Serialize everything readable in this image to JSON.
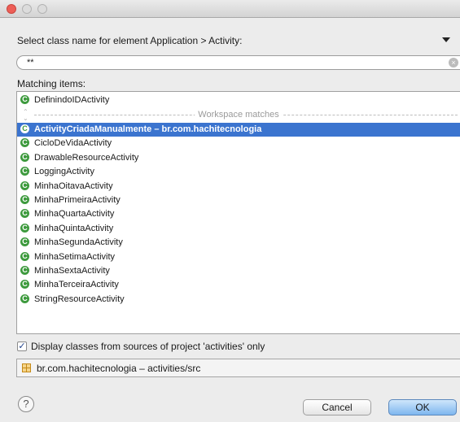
{
  "prompt": "Select class name for element Application > Activity:",
  "search": {
    "value": "**"
  },
  "matching_label": "Matching items:",
  "class_icon": "C",
  "list": {
    "top_item": "DefinindoIDActivity",
    "separator": "Workspace matches",
    "items": [
      "ActivityCriadaManualmente – br.com.hachitecnologia",
      "CicloDeVidaActivity",
      "DrawableResourceActivity",
      "LoggingActivity",
      "MinhaOitavaActivity",
      "MinhaPrimeiraActivity",
      "MinhaQuartaActivity",
      "MinhaQuintaActivity",
      "MinhaSegundaActivity",
      "MinhaSetimaActivity",
      "MinhaSextaActivity",
      "MinhaTerceiraActivity",
      "StringResourceActivity"
    ],
    "selected_index": 0
  },
  "checkbox": {
    "label": "Display classes from sources of project 'activities' only",
    "checked": true
  },
  "location": "br.com.hachitecnologia – activities/src",
  "buttons": {
    "help": "?",
    "cancel": "Cancel",
    "ok": "OK"
  },
  "colors": {
    "selection": "#3b74cf",
    "class_icon": "#3d9a3d",
    "close_button": "#ed5e57"
  }
}
